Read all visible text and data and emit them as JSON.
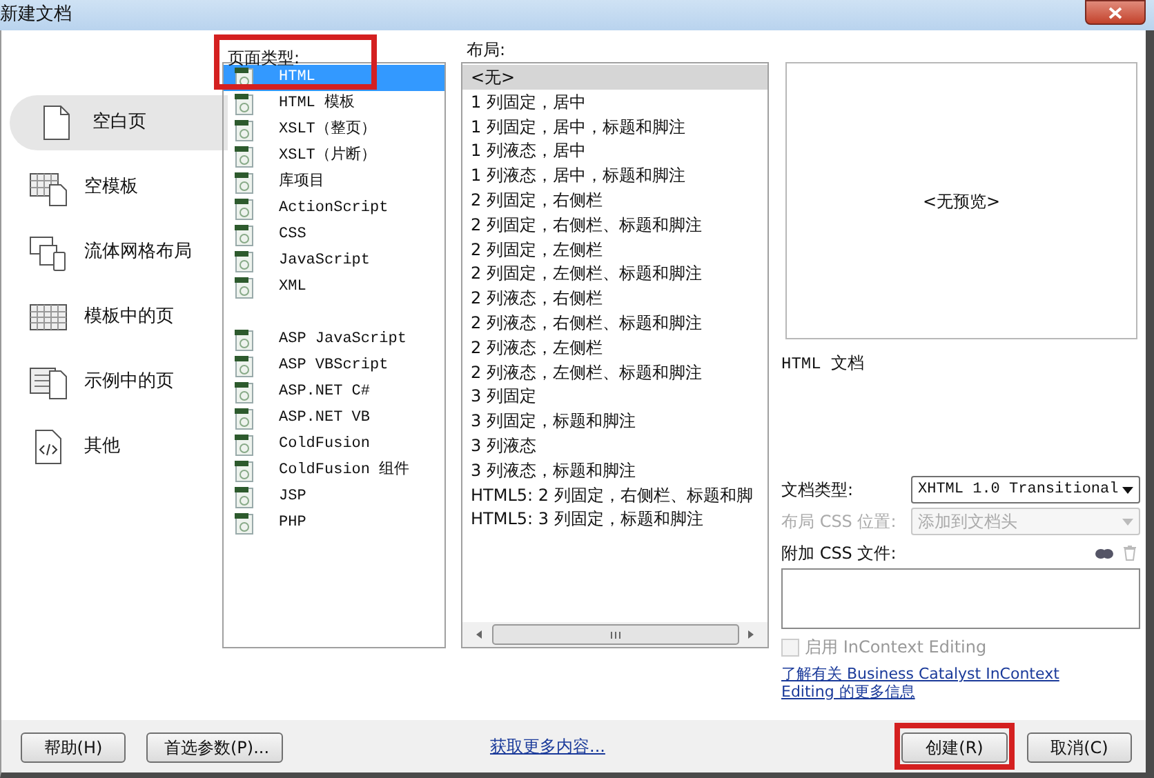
{
  "window": {
    "title": "新建文档"
  },
  "sidebar": {
    "items": [
      {
        "label": "空白页",
        "kind": "blank",
        "selected": true
      },
      {
        "label": "空模板",
        "kind": "template",
        "selected": false
      },
      {
        "label": "流体网格布局",
        "kind": "fluid",
        "selected": false
      },
      {
        "label": "模板中的页",
        "kind": "grid",
        "selected": false
      },
      {
        "label": "示例中的页",
        "kind": "sample",
        "selected": false
      },
      {
        "label": "其他",
        "kind": "code",
        "selected": false
      }
    ]
  },
  "page_type": {
    "label": "页面类型:",
    "highlighted": true,
    "groups": [
      [
        {
          "label": "HTML",
          "selected": true
        },
        {
          "label": "HTML 模板",
          "selected": false
        },
        {
          "label": "XSLT（整页）",
          "selected": false
        },
        {
          "label": "XSLT（片断）",
          "selected": false
        },
        {
          "label": "库项目",
          "selected": false
        },
        {
          "label": "ActionScript",
          "selected": false
        },
        {
          "label": "CSS",
          "selected": false
        },
        {
          "label": "JavaScript",
          "selected": false
        },
        {
          "label": "XML",
          "selected": false
        }
      ],
      [
        {
          "label": "ASP JavaScript",
          "selected": false
        },
        {
          "label": "ASP VBScript",
          "selected": false
        },
        {
          "label": "ASP.NET C#",
          "selected": false
        },
        {
          "label": "ASP.NET VB",
          "selected": false
        },
        {
          "label": "ColdFusion",
          "selected": false
        },
        {
          "label": "ColdFusion 组件",
          "selected": false
        },
        {
          "label": "JSP",
          "selected": false
        },
        {
          "label": "PHP",
          "selected": false
        }
      ]
    ]
  },
  "layout": {
    "label": "布局:",
    "items": [
      {
        "label": "<无>",
        "selected": true
      },
      {
        "label": "1 列固定，居中",
        "selected": false
      },
      {
        "label": "1 列固定，居中，标题和脚注",
        "selected": false
      },
      {
        "label": "1 列液态，居中",
        "selected": false
      },
      {
        "label": "1 列液态，居中，标题和脚注",
        "selected": false
      },
      {
        "label": "2 列固定，右侧栏",
        "selected": false
      },
      {
        "label": "2 列固定，右侧栏、标题和脚注",
        "selected": false
      },
      {
        "label": "2 列固定，左侧栏",
        "selected": false
      },
      {
        "label": "2 列固定，左侧栏、标题和脚注",
        "selected": false
      },
      {
        "label": "2 列液态，右侧栏",
        "selected": false
      },
      {
        "label": "2 列液态，右侧栏、标题和脚注",
        "selected": false
      },
      {
        "label": "2 列液态，左侧栏",
        "selected": false
      },
      {
        "label": "2 列液态，左侧栏、标题和脚注",
        "selected": false
      },
      {
        "label": "3 列固定",
        "selected": false
      },
      {
        "label": "3 列固定，标题和脚注",
        "selected": false
      },
      {
        "label": "3 列液态",
        "selected": false
      },
      {
        "label": "3 列液态，标题和脚注",
        "selected": false
      },
      {
        "label": "HTML5: 2 列固定，右侧栏、标题和脚",
        "selected": false
      },
      {
        "label": "HTML5: 3 列固定，标题和脚注",
        "selected": false
      }
    ]
  },
  "preview": {
    "text": "<无预览>",
    "description": "HTML 文档"
  },
  "doc_type": {
    "label": "文档类型:",
    "value": "XHTML 1.0 Transitional"
  },
  "css_position": {
    "label": "布局 CSS 位置:",
    "value": "添加到文档头",
    "disabled": true
  },
  "attach_css": {
    "label": "附加 CSS 文件:"
  },
  "incontext": {
    "label": "启用 InContext Editing",
    "checked": false,
    "disabled": true
  },
  "learn_link": "了解有关 Business Catalyst InContext Editing 的更多信息",
  "footer": {
    "help": "帮助(H)",
    "prefs": "首选参数(P)...",
    "more": "获取更多内容...",
    "create": "创建(R)",
    "create_highlighted": true,
    "cancel": "取消(C)"
  }
}
